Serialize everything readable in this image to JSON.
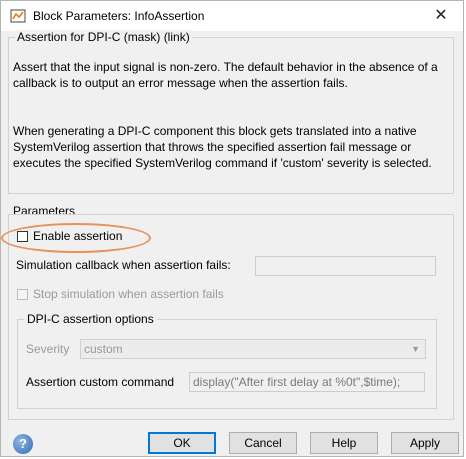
{
  "window": {
    "title": "Block Parameters: InfoAssertion",
    "close_glyph": "✕",
    "icon": "simulink-block-icon"
  },
  "mask": {
    "header": "Assertion for DPI-C (mask) (link)",
    "description_1": "Assert that the input signal is non-zero. The default behavior in the absence of a callback is to output an error message when the assertion fails.",
    "description_2": "When generating a DPI-C component this block gets translated into a native SystemVerilog assertion that throws the specified assertion fail message or executes the specified SystemVerilog command if 'custom' severity is selected."
  },
  "parameters": {
    "header": "Parameters",
    "enable_assertion": {
      "label": "Enable assertion",
      "checked": false
    },
    "sim_callback": {
      "label": "Simulation callback when assertion fails:",
      "value": ""
    },
    "stop_sim": {
      "label": "Stop simulation when assertion fails",
      "checked": false,
      "enabled": false
    },
    "highlight_color": "#e8925a"
  },
  "dpic_options": {
    "header": "DPI-C assertion options",
    "severity_label": "Severity",
    "severity_value": "custom",
    "command_label": "Assertion custom command",
    "command_value": "display(\"After first delay at %0t\",$time);"
  },
  "buttons": {
    "ok": "OK",
    "cancel": "Cancel",
    "help": "Help",
    "apply": "Apply"
  },
  "help_icon": "?"
}
